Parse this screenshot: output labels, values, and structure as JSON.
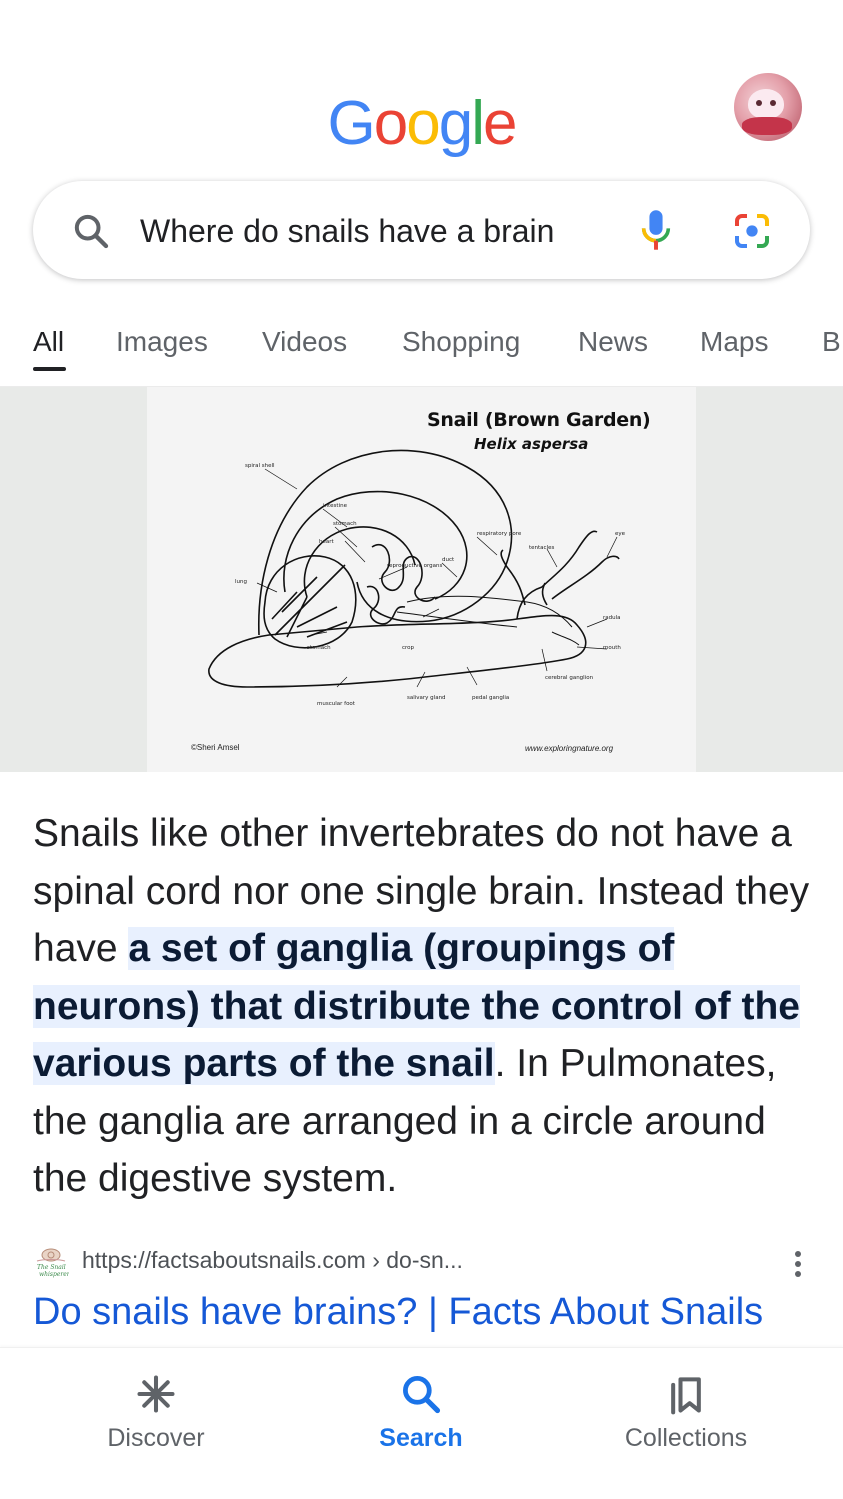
{
  "header": {
    "logo_letters": [
      "G",
      "o",
      "o",
      "g",
      "l",
      "e"
    ],
    "logo_colors": [
      "#4285F4",
      "#EA4335",
      "#FBBC05",
      "#4285F4",
      "#34A853",
      "#EA4335"
    ]
  },
  "search": {
    "query": "Where do snails have a brain",
    "search_icon": "search-icon",
    "voice_icon": "mic-icon",
    "lens_icon": "camera-lens-icon"
  },
  "tabs": [
    {
      "label": "All",
      "active": true
    },
    {
      "label": "Images",
      "active": false
    },
    {
      "label": "Videos",
      "active": false
    },
    {
      "label": "Shopping",
      "active": false
    },
    {
      "label": "News",
      "active": false
    },
    {
      "label": "Maps",
      "active": false
    },
    {
      "label": "B",
      "active": false
    }
  ],
  "featured_image": {
    "title": "Snail (Brown Garden)",
    "subtitle": "Helix aspersa",
    "copyright": "©Sheri Amsel",
    "source": "www.exploringnature.org"
  },
  "snippet": {
    "before": "Snails like other invertebrates do not have a spinal cord nor one single brain. Instead they have ",
    "highlight": "a set of ganglia (groupings of neurons) that distribute the control of the various parts of the snail",
    "after": ". In Pulmonates, the ganglia are arranged in a circle around the digestive system."
  },
  "result": {
    "url": "https://factsaboutsnails.com › do-sn...",
    "title": "Do snails have brains? | Facts About Snails",
    "menu_icon": "more-vert-icon"
  },
  "bottom_nav": [
    {
      "label": "Discover",
      "icon": "asterisk-icon",
      "active": false
    },
    {
      "label": "Search",
      "icon": "search-icon",
      "active": true
    },
    {
      "label": "Collections",
      "icon": "bookmarks-icon",
      "active": false
    }
  ],
  "colors": {
    "accent_blue": "#1a73e8",
    "link_blue": "#1558d6",
    "highlight_bg": "#e8f0fe",
    "text_primary": "#202124",
    "text_secondary": "#5f6368"
  }
}
